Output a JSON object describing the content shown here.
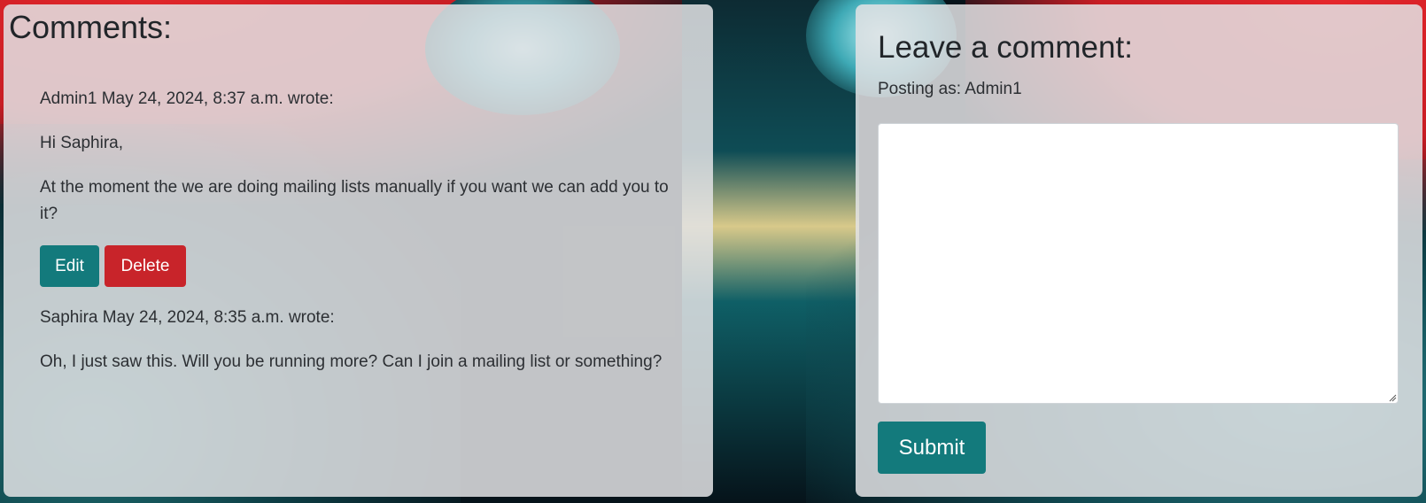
{
  "comments_section": {
    "title": "Comments:",
    "comments": [
      {
        "author": "Admin1",
        "timestamp": "May 24, 2024, 8:37 a.m.",
        "meta_text": "Admin1 May 24, 2024, 8:37 a.m. wrote:",
        "greeting": "Hi Saphira,",
        "body": "At the moment the we are doing mailing lists manually if you want we can add you to it?",
        "actions": {
          "edit_label": "Edit",
          "delete_label": "Delete"
        }
      },
      {
        "author": "Saphira",
        "timestamp": "May 24, 2024, 8:35 a.m.",
        "meta_text": "Saphira May 24, 2024, 8:35 a.m. wrote:",
        "body": "Oh, I just saw this. Will you be running more? Can I join a mailing list or something?"
      }
    ]
  },
  "comment_form": {
    "title": "Leave a comment:",
    "posting_as": "Posting as: Admin1",
    "textarea_value": "",
    "submit_label": "Submit"
  },
  "colors": {
    "primary_button": "#137a7c",
    "danger_button": "#c8242a",
    "panel_background": "#e2e2e4"
  }
}
